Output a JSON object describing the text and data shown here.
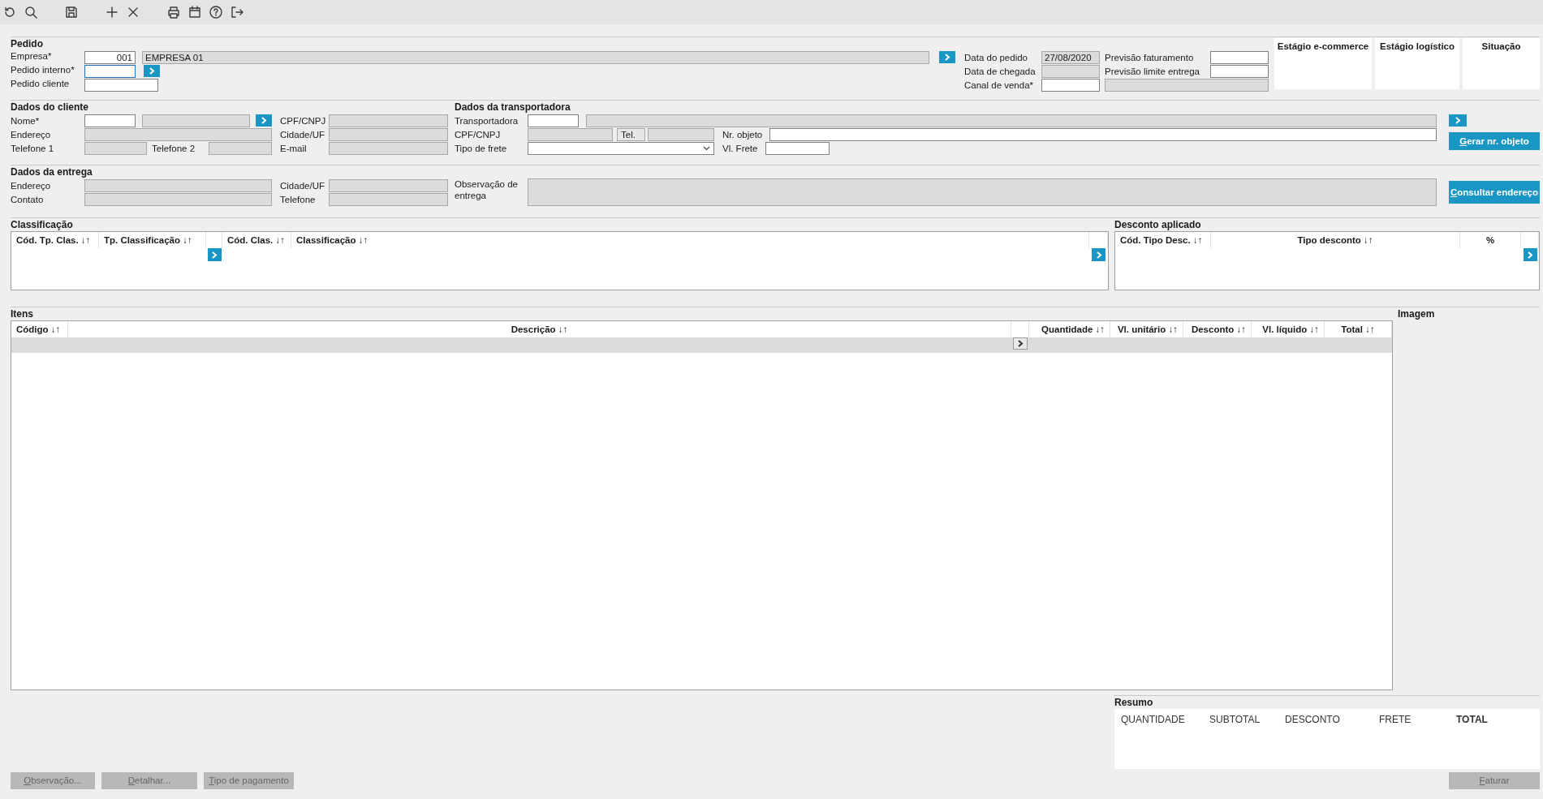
{
  "pedido": {
    "title": "Pedido",
    "empresa_codigo": {
      "label": "Empresa*",
      "value": "001",
      "disabled": false
    },
    "empresa_nome": {
      "value": "EMPRESA 01",
      "disabled": true
    },
    "pedido_interno": {
      "label": "Pedido interno*",
      "disabled": false,
      "focused": true
    },
    "pedido_cliente": {
      "label": "Pedido cliente",
      "disabled": false
    },
    "data_pedido": {
      "label": "Data do pedido",
      "value": "27/08/2020",
      "disabled": true
    },
    "data_chegada": {
      "label": "Data de chegada",
      "disabled": true
    },
    "canal_venda": {
      "label": "Canal de venda*",
      "disabled": false
    },
    "canal_venda_descricao": {
      "disabled": true
    },
    "previsao_faturamento": {
      "label": "Previsão faturamento",
      "disabled": false
    },
    "previsao_limite_entrega": {
      "label": "Previsão limite entrega",
      "disabled": false
    }
  },
  "status_panels": [
    {
      "title": "Estágio e-commerce"
    },
    {
      "title": "Estágio logístico"
    },
    {
      "title": "Situação"
    }
  ],
  "cliente": {
    "title": "Dados do cliente",
    "nome_codigo": {
      "label": "Nome*",
      "disabled": false
    },
    "nome": {
      "disabled": true
    },
    "cpf_cnpj": {
      "label": "CPF/CNPJ",
      "disabled": true
    },
    "endereco": {
      "label": "Endereço",
      "disabled": true
    },
    "cidade_uf": {
      "label": "Cidade/UF",
      "disabled": true
    },
    "telefone_1": {
      "label": "Telefone 1",
      "disabled": true
    },
    "telefone_2": {
      "label": "Telefone 2",
      "disabled": true
    },
    "email": {
      "label": "E-mail",
      "disabled": true
    }
  },
  "transportadora": {
    "title": "Dados da transportadora",
    "codigo": {
      "label": "Transportadora",
      "disabled": false
    },
    "nome": {
      "disabled": true
    },
    "cpf_cnpj": {
      "label": "CPF/CNPJ",
      "disabled": true
    },
    "telefone": {
      "label": "Tel.",
      "disabled": true
    },
    "nr_objeto": {
      "label": "Nr. objeto",
      "disabled": false
    },
    "tipo_frete": {
      "label": "Tipo de frete",
      "disabled": false
    },
    "vl_frete": {
      "label": "Vl. Frete",
      "disabled": false
    },
    "gerar_button": {
      "label": "Gerar nr. objeto",
      "disabled": false
    }
  },
  "entrega": {
    "title": "Dados da entrega",
    "endereco": {
      "label": "Endereço",
      "disabled": true
    },
    "contato": {
      "label": "Contato",
      "disabled": true
    },
    "cidade_uf": {
      "label": "Cidade/UF",
      "disabled": true
    },
    "telefone": {
      "label": "Telefone",
      "disabled": true
    },
    "observacao": {
      "label": "Observação de entrega",
      "disabled": true
    },
    "consultar_button": {
      "label": "Consultar endereço",
      "disabled": false
    }
  },
  "classificacao": {
    "title": "Classificação",
    "columns": [
      {
        "kind": "header",
        "label": "Cód. Tp. Clas. ↓↑"
      },
      {
        "kind": "header",
        "label": "Tp. Classificação ↓↑"
      },
      {
        "kind": "lookup"
      },
      {
        "kind": "header",
        "label": "Cód. Clas. ↓↑"
      },
      {
        "kind": "header",
        "label": "Classificação ↓↑"
      },
      {
        "kind": "lookup"
      }
    ]
  },
  "desconto": {
    "title": "Desconto aplicado",
    "columns": [
      {
        "kind": "header",
        "label": "Cód. Tipo Desc. ↓↑"
      },
      {
        "kind": "header",
        "label": "Tipo desconto ↓↑"
      },
      {
        "kind": "header",
        "label": "%"
      },
      {
        "kind": "lookup"
      }
    ]
  },
  "itens": {
    "title": "Itens",
    "columns": [
      {
        "kind": "header",
        "label": "Código ↓↑"
      },
      {
        "kind": "header",
        "label": "Descrição ↓↑"
      },
      {
        "kind": "lookup"
      },
      {
        "kind": "header",
        "label": "Quantidade ↓↑"
      },
      {
        "kind": "header",
        "label": "Vl. unitário ↓↑"
      },
      {
        "kind": "header",
        "label": "Desconto ↓↑"
      },
      {
        "kind": "header",
        "label": "Vl. líquido ↓↑"
      },
      {
        "kind": "header",
        "label": "Total ↓↑"
      }
    ]
  },
  "imagem": {
    "title": "Imagem"
  },
  "resumo": {
    "title": "Resumo",
    "totals": [
      {
        "kind": "amount",
        "label": "QUANTIDADE"
      },
      {
        "kind": "amount",
        "label": "SUBTOTAL"
      },
      {
        "kind": "amount",
        "label": "DESCONTO"
      },
      {
        "kind": "amount",
        "label": "FRETE"
      },
      {
        "kind": "total",
        "label": "TOTAL"
      }
    ]
  },
  "footer_buttons": [
    {
      "label": "Observação...",
      "disabled": true
    },
    {
      "label": "Detalhar...",
      "disabled": true
    },
    {
      "label": "Tipo de pagamento",
      "disabled": true
    }
  ],
  "faturar_button": {
    "label": "Faturar",
    "disabled": true
  }
}
